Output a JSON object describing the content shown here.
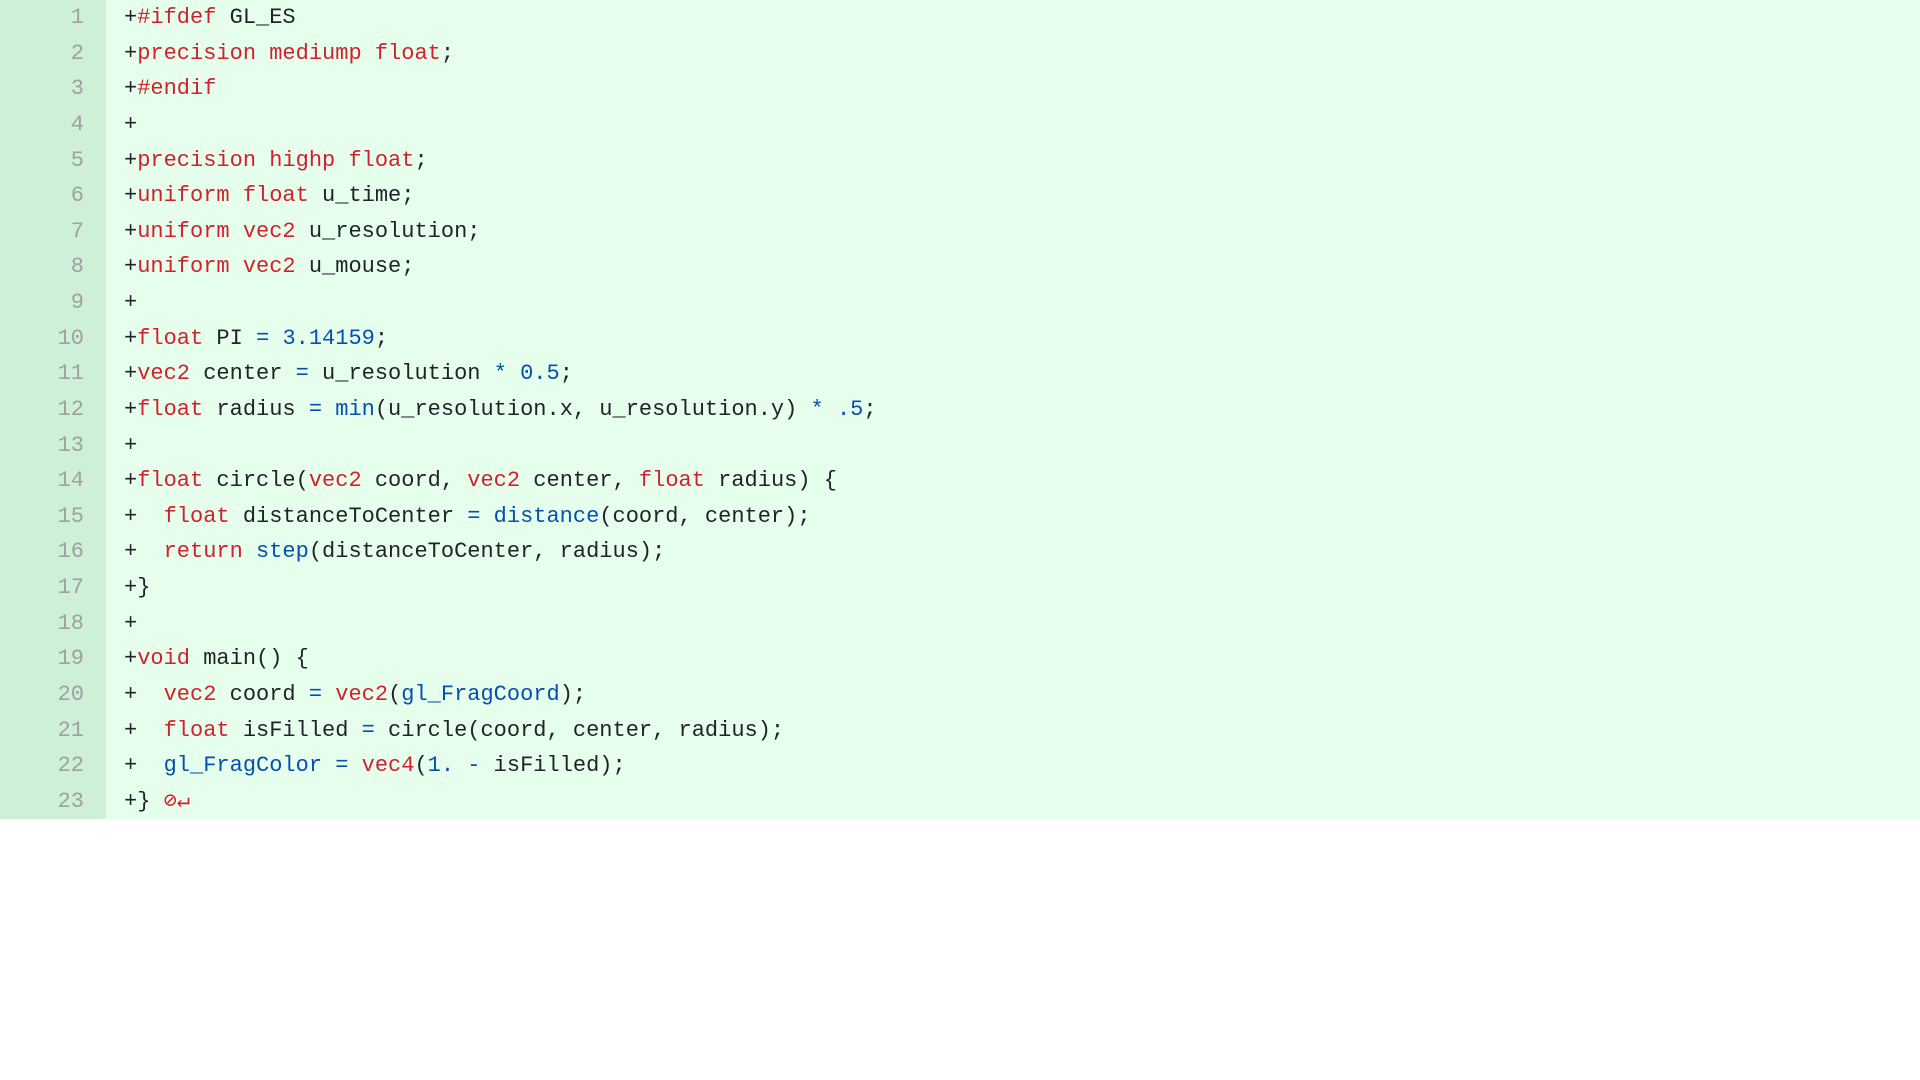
{
  "lines": [
    {
      "num": "1",
      "tokens": [
        {
          "t": "+",
          "c": "plus"
        },
        {
          "t": "#ifdef",
          "c": "kw-pre"
        },
        {
          "t": " GL_ES",
          "c": "ident"
        }
      ]
    },
    {
      "num": "2",
      "tokens": [
        {
          "t": "+",
          "c": "plus"
        },
        {
          "t": "precision",
          "c": "kw-type"
        },
        {
          "t": " ",
          "c": "ident"
        },
        {
          "t": "mediump",
          "c": "kw-type"
        },
        {
          "t": " ",
          "c": "ident"
        },
        {
          "t": "float",
          "c": "kw-type"
        },
        {
          "t": ";",
          "c": "punct"
        }
      ]
    },
    {
      "num": "3",
      "tokens": [
        {
          "t": "+",
          "c": "plus"
        },
        {
          "t": "#endif",
          "c": "kw-pre"
        }
      ]
    },
    {
      "num": "4",
      "tokens": [
        {
          "t": "+",
          "c": "plus"
        }
      ]
    },
    {
      "num": "5",
      "tokens": [
        {
          "t": "+",
          "c": "plus"
        },
        {
          "t": "precision",
          "c": "kw-type"
        },
        {
          "t": " ",
          "c": "ident"
        },
        {
          "t": "highp",
          "c": "kw-type"
        },
        {
          "t": " ",
          "c": "ident"
        },
        {
          "t": "float",
          "c": "kw-type"
        },
        {
          "t": ";",
          "c": "punct"
        }
      ]
    },
    {
      "num": "6",
      "tokens": [
        {
          "t": "+",
          "c": "plus"
        },
        {
          "t": "uniform",
          "c": "kw-type"
        },
        {
          "t": " ",
          "c": "ident"
        },
        {
          "t": "float",
          "c": "kw-type"
        },
        {
          "t": " u_time;",
          "c": "ident"
        }
      ]
    },
    {
      "num": "7",
      "tokens": [
        {
          "t": "+",
          "c": "plus"
        },
        {
          "t": "uniform",
          "c": "kw-type"
        },
        {
          "t": " ",
          "c": "ident"
        },
        {
          "t": "vec2",
          "c": "kw-type"
        },
        {
          "t": " u_resolution;",
          "c": "ident"
        }
      ]
    },
    {
      "num": "8",
      "tokens": [
        {
          "t": "+",
          "c": "plus"
        },
        {
          "t": "uniform",
          "c": "kw-type"
        },
        {
          "t": " ",
          "c": "ident"
        },
        {
          "t": "vec2",
          "c": "kw-type"
        },
        {
          "t": " u_mouse;",
          "c": "ident"
        }
      ]
    },
    {
      "num": "9",
      "tokens": [
        {
          "t": "+",
          "c": "plus"
        }
      ]
    },
    {
      "num": "10",
      "tokens": [
        {
          "t": "+",
          "c": "plus"
        },
        {
          "t": "float",
          "c": "kw-type"
        },
        {
          "t": " PI ",
          "c": "ident"
        },
        {
          "t": "=",
          "c": "op"
        },
        {
          "t": " ",
          "c": "ident"
        },
        {
          "t": "3.14159",
          "c": "num"
        },
        {
          "t": ";",
          "c": "punct"
        }
      ]
    },
    {
      "num": "11",
      "tokens": [
        {
          "t": "+",
          "c": "plus"
        },
        {
          "t": "vec2",
          "c": "kw-type"
        },
        {
          "t": " center ",
          "c": "ident"
        },
        {
          "t": "=",
          "c": "op"
        },
        {
          "t": " u_resolution ",
          "c": "ident"
        },
        {
          "t": "*",
          "c": "op"
        },
        {
          "t": " ",
          "c": "ident"
        },
        {
          "t": "0.5",
          "c": "num"
        },
        {
          "t": ";",
          "c": "punct"
        }
      ]
    },
    {
      "num": "12",
      "tokens": [
        {
          "t": "+",
          "c": "plus"
        },
        {
          "t": "float",
          "c": "kw-type"
        },
        {
          "t": " radius ",
          "c": "ident"
        },
        {
          "t": "=",
          "c": "op"
        },
        {
          "t": " ",
          "c": "ident"
        },
        {
          "t": "min",
          "c": "builtin"
        },
        {
          "t": "(u_resolution.x, u_resolution.y) ",
          "c": "ident"
        },
        {
          "t": "*",
          "c": "op"
        },
        {
          "t": " ",
          "c": "ident"
        },
        {
          "t": ".5",
          "c": "num"
        },
        {
          "t": ";",
          "c": "punct"
        }
      ]
    },
    {
      "num": "13",
      "tokens": [
        {
          "t": "+",
          "c": "plus"
        }
      ]
    },
    {
      "num": "14",
      "tokens": [
        {
          "t": "+",
          "c": "plus"
        },
        {
          "t": "float",
          "c": "kw-type"
        },
        {
          "t": " ",
          "c": "ident"
        },
        {
          "t": "circle",
          "c": "ident"
        },
        {
          "t": "(",
          "c": "punct"
        },
        {
          "t": "vec2",
          "c": "kw-type"
        },
        {
          "t": " coord, ",
          "c": "ident"
        },
        {
          "t": "vec2",
          "c": "kw-type"
        },
        {
          "t": " center, ",
          "c": "ident"
        },
        {
          "t": "float",
          "c": "kw-type"
        },
        {
          "t": " radius) {",
          "c": "ident"
        }
      ]
    },
    {
      "num": "15",
      "tokens": [
        {
          "t": "+",
          "c": "plus"
        },
        {
          "t": "  ",
          "c": "ident"
        },
        {
          "t": "float",
          "c": "kw-type"
        },
        {
          "t": " distanceToCenter ",
          "c": "ident"
        },
        {
          "t": "=",
          "c": "op"
        },
        {
          "t": " ",
          "c": "ident"
        },
        {
          "t": "distance",
          "c": "builtin"
        },
        {
          "t": "(coord, center);",
          "c": "ident"
        }
      ]
    },
    {
      "num": "16",
      "tokens": [
        {
          "t": "+",
          "c": "plus"
        },
        {
          "t": "  ",
          "c": "ident"
        },
        {
          "t": "return",
          "c": "kw-ret"
        },
        {
          "t": " ",
          "c": "ident"
        },
        {
          "t": "step",
          "c": "builtin"
        },
        {
          "t": "(distanceToCenter, radius);",
          "c": "ident"
        }
      ]
    },
    {
      "num": "17",
      "tokens": [
        {
          "t": "+",
          "c": "plus"
        },
        {
          "t": "}",
          "c": "punct"
        }
      ]
    },
    {
      "num": "18",
      "tokens": [
        {
          "t": "+",
          "c": "plus"
        }
      ]
    },
    {
      "num": "19",
      "tokens": [
        {
          "t": "+",
          "c": "plus"
        },
        {
          "t": "void",
          "c": "kw-type"
        },
        {
          "t": " ",
          "c": "ident"
        },
        {
          "t": "main",
          "c": "ident"
        },
        {
          "t": "() {",
          "c": "punct"
        }
      ]
    },
    {
      "num": "20",
      "tokens": [
        {
          "t": "+",
          "c": "plus"
        },
        {
          "t": "  ",
          "c": "ident"
        },
        {
          "t": "vec2",
          "c": "kw-type"
        },
        {
          "t": " coord ",
          "c": "ident"
        },
        {
          "t": "=",
          "c": "op"
        },
        {
          "t": " ",
          "c": "ident"
        },
        {
          "t": "vec2",
          "c": "kw-type"
        },
        {
          "t": "(",
          "c": "punct"
        },
        {
          "t": "gl_FragCoord",
          "c": "builtin"
        },
        {
          "t": ");",
          "c": "punct"
        }
      ]
    },
    {
      "num": "21",
      "tokens": [
        {
          "t": "+",
          "c": "plus"
        },
        {
          "t": "  ",
          "c": "ident"
        },
        {
          "t": "float",
          "c": "kw-type"
        },
        {
          "t": " isFilled ",
          "c": "ident"
        },
        {
          "t": "=",
          "c": "op"
        },
        {
          "t": " circle(coord, center, radius);",
          "c": "ident"
        }
      ]
    },
    {
      "num": "22",
      "tokens": [
        {
          "t": "+",
          "c": "plus"
        },
        {
          "t": "  ",
          "c": "ident"
        },
        {
          "t": "gl_FragColor",
          "c": "builtin"
        },
        {
          "t": " ",
          "c": "ident"
        },
        {
          "t": "=",
          "c": "op"
        },
        {
          "t": " ",
          "c": "ident"
        },
        {
          "t": "vec4",
          "c": "kw-type"
        },
        {
          "t": "(",
          "c": "punct"
        },
        {
          "t": "1.",
          "c": "num"
        },
        {
          "t": " ",
          "c": "ident"
        },
        {
          "t": "-",
          "c": "op"
        },
        {
          "t": " isFilled);",
          "c": "ident"
        }
      ]
    },
    {
      "num": "23",
      "tokens": [
        {
          "t": "+",
          "c": "plus"
        },
        {
          "t": "}",
          "c": "punct"
        },
        {
          "t": " ",
          "c": "ident"
        },
        {
          "t": "⊘↵",
          "c": "eol-marker"
        }
      ]
    }
  ]
}
